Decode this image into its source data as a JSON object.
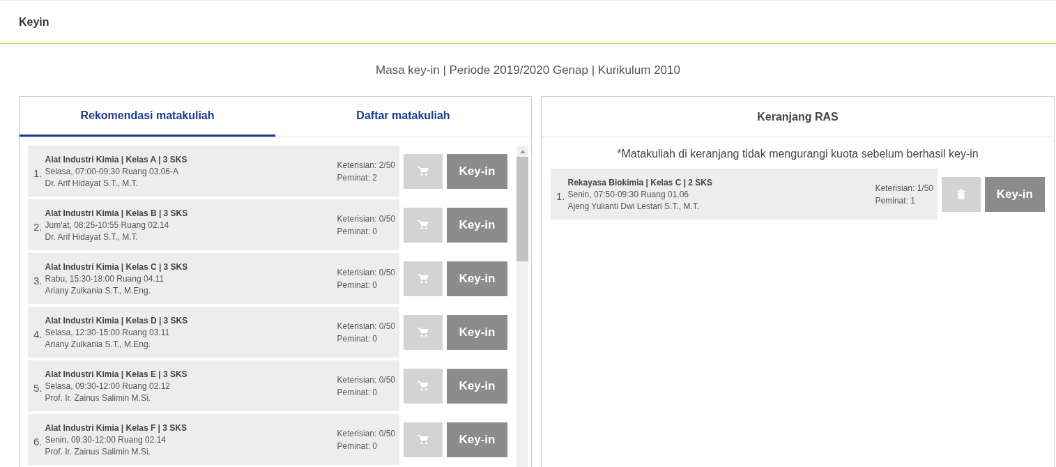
{
  "header": {
    "title": "Keyin"
  },
  "subtitle": "Masa key-in | Periode 2019/2020 Genap | Kurikulum 2010",
  "tabs": [
    {
      "label": "Rekomendasi matakuliah",
      "selected": true
    },
    {
      "label": "Daftar matakuliah",
      "selected": false
    }
  ],
  "courses": [
    {
      "number": "1.",
      "title": "Alat Industri Kimia | Kelas A | 3 SKS",
      "schedule": "Selasa, 07:00-09:30 Ruang 03.06-A",
      "lecturer": "Dr. Arif Hidayat S.T., M.T.",
      "filled": "Keterisian: 2/50",
      "interest": "Peminat: 2",
      "button": "Key-in"
    },
    {
      "number": "2.",
      "title": "Alat Industri Kimia | Kelas B | 3 SKS",
      "schedule": "Jum'at, 08:25-10:55 Ruang 02.14",
      "lecturer": "Dr. Arif Hidayat S.T., M.T.",
      "filled": "Keterisian: 0/50",
      "interest": "Peminat: 0",
      "button": "Key-in"
    },
    {
      "number": "3.",
      "title": "Alat Industri Kimia | Kelas C | 3 SKS",
      "schedule": "Rabu, 15:30-18:00 Ruang 04.11",
      "lecturer": "Ariany Zulkania S.T., M.Eng.",
      "filled": "Keterisian: 0/50",
      "interest": "Peminat: 0",
      "button": "Key-in"
    },
    {
      "number": "4.",
      "title": "Alat Industri Kimia | Kelas D | 3 SKS",
      "schedule": "Selasa, 12:30-15:00 Ruang 03.11",
      "lecturer": "Ariany Zulkania S.T., M.Eng.",
      "filled": "Keterisian: 0/50",
      "interest": "Peminat: 0",
      "button": "Key-in"
    },
    {
      "number": "5.",
      "title": "Alat Industri Kimia | Kelas E | 3 SKS",
      "schedule": "Selasa, 09:30-12:00 Ruang 02.12",
      "lecturer": "Prof. Ir. Zainus Salimin M.Si.",
      "filled": "Keterisian: 0/50",
      "interest": "Peminat: 0",
      "button": "Key-in"
    },
    {
      "number": "6.",
      "title": "Alat Industri Kimia | Kelas F | 3 SKS",
      "schedule": "Senin, 09:30-12:00 Ruang 02.14",
      "lecturer": "Prof. Ir. Zainus Salimin M.Si.",
      "filled": "Keterisian: 0/50",
      "interest": "Peminat: 0",
      "button": "Key-in"
    }
  ],
  "cart": {
    "title": "Keranjang RAS",
    "note": "*Matakuliah di keranjang tidak mengurangi kuota sebelum berhasil key-in",
    "items": [
      {
        "number": "1.",
        "title": "Rekayasa Biokimia | Kelas C | 2 SKS",
        "schedule": "Senin, 07:50-09:30 Ruang 01.06",
        "lecturer": "Ajeng Yulianti Dwi Lestari S.T., M.T.",
        "filled": "Keterisian: 1/50",
        "interest": "Peminat: 1",
        "button": "Key-in"
      }
    ]
  }
}
